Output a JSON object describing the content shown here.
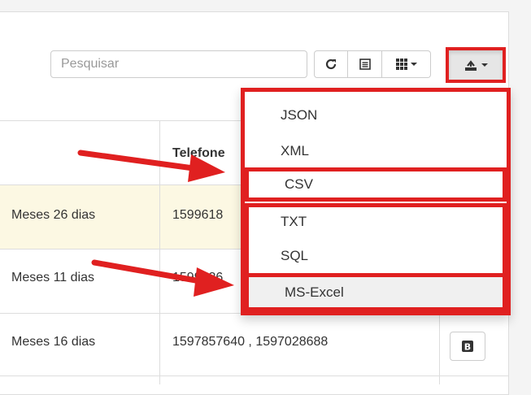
{
  "toolbar": {
    "search_placeholder": "Pesquisar",
    "icons": [
      "refresh-icon",
      "list-view-icon",
      "columns-icon",
      "export-icon"
    ]
  },
  "table": {
    "header_phone": "Telefone",
    "rows": [
      {
        "duration": "Meses 26 dias",
        "phones": "1599618"
      },
      {
        "duration": "Meses 11 dias",
        "phones": "1599636"
      },
      {
        "duration": "Meses 16 dias",
        "phones": "1597857640 , 1597028688"
      }
    ]
  },
  "export_menu": {
    "items": [
      "JSON",
      "XML",
      "CSV",
      "TXT",
      "SQL",
      "MS-Excel"
    ],
    "hovered": "MS-Excel"
  },
  "colors": {
    "highlight": "#e02020",
    "row_highlight": "#fcf8e3"
  }
}
